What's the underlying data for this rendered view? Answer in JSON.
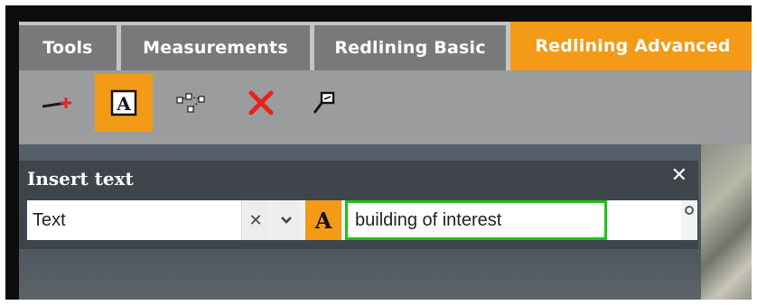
{
  "tabs": [
    {
      "label": "Tools",
      "active": false
    },
    {
      "label": "Measurements",
      "active": false
    },
    {
      "label": "Redlining Basic",
      "active": false
    },
    {
      "label": "Redlining Advanced",
      "active": true
    }
  ],
  "toolbar": {
    "tools": [
      {
        "icon": "draw-line-icon",
        "active": false
      },
      {
        "icon": "insert-text-icon",
        "active": true
      },
      {
        "icon": "edit-vertices-icon",
        "active": false
      },
      {
        "icon": "delete-icon",
        "active": false
      },
      {
        "icon": "label-callout-icon",
        "active": false
      }
    ]
  },
  "panel": {
    "title": "Insert text",
    "close_glyph": "✕",
    "type_value": "Text",
    "clear_glyph": "✕",
    "font_glyph": "A",
    "text_value": "building of interest"
  },
  "colors": {
    "accent": "#f39a17",
    "tab_inactive": "#78797b",
    "input_focus": "#22c21a",
    "delete_red": "#e8231a"
  }
}
